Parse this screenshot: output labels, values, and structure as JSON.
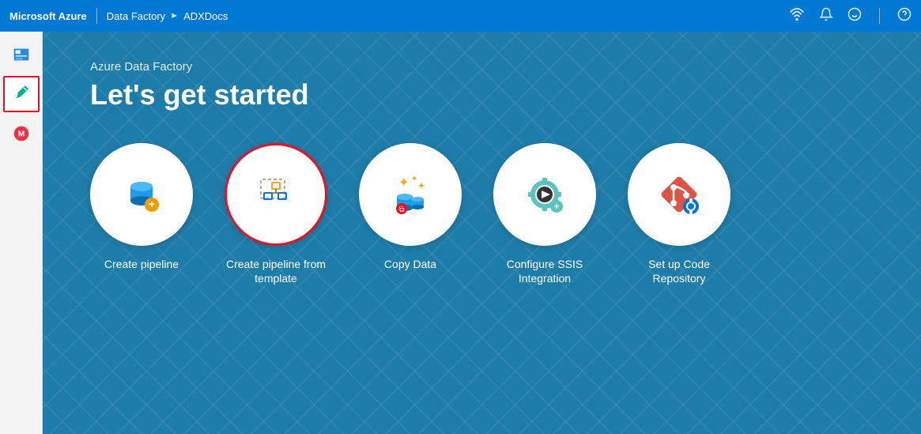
{
  "topbar": {
    "brand": "Microsoft Azure",
    "breadcrumb": [
      "Data Factory",
      "ADXDocs"
    ],
    "icons": [
      "wifi-icon",
      "bell-icon",
      "emoji-icon",
      "help-icon"
    ]
  },
  "sidebar": {
    "items": [
      {
        "name": "author-icon",
        "active": false
      },
      {
        "name": "pencil-icon",
        "active": true
      },
      {
        "name": "monitor-icon",
        "active": false
      }
    ]
  },
  "content": {
    "subtitle": "Azure Data Factory",
    "title": "Let's get started",
    "cards": [
      {
        "id": "create-pipeline",
        "label": "Create pipeline",
        "highlighted": false
      },
      {
        "id": "create-pipeline-template",
        "label": "Create pipeline from template",
        "highlighted": true
      },
      {
        "id": "copy-data",
        "label": "Copy Data",
        "highlighted": false
      },
      {
        "id": "configure-ssis",
        "label": "Configure SSIS Integration",
        "highlighted": false
      },
      {
        "id": "setup-code-repo",
        "label": "Set up Code Repository",
        "highlighted": false
      }
    ]
  }
}
